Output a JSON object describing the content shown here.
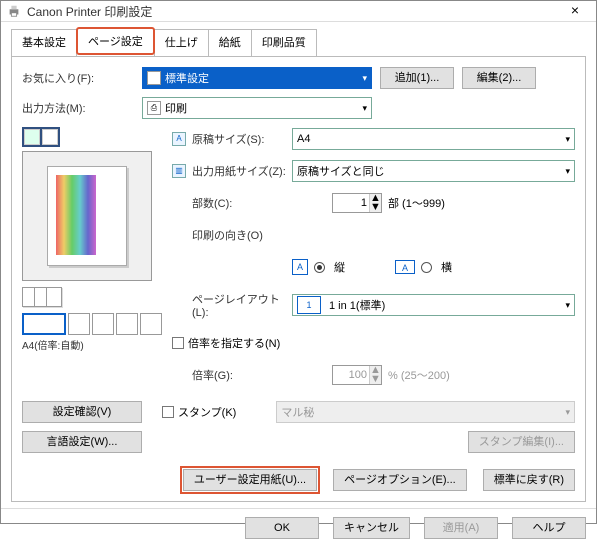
{
  "title": "Canon Printer 印刷設定",
  "tabs": [
    "基本設定",
    "ページ設定",
    "仕上げ",
    "給紙",
    "印刷品質"
  ],
  "favorite": {
    "label": "お気に入り(F):",
    "value": "標準設定",
    "add": "追加(1)...",
    "edit": "編集(2)..."
  },
  "output": {
    "label": "出力方法(M):",
    "value": "印刷"
  },
  "preview_label": "A4(倍率:自動)",
  "page_size": {
    "label": "原稿サイズ(S):",
    "value": "A4"
  },
  "out_size": {
    "label": "出力用紙サイズ(Z):",
    "value": "原稿サイズと同じ"
  },
  "copies": {
    "label": "部数(C):",
    "value": "1",
    "suffix": "部 (1～999)"
  },
  "orient": {
    "label": "印刷の向き(O)",
    "portrait": "縦",
    "landscape": "横"
  },
  "layout": {
    "label": "ページレイアウト(L):",
    "value": "1 in 1(標準)",
    "icon": "1"
  },
  "scale_chk": "倍率を指定する(N)",
  "scale": {
    "label": "倍率(G):",
    "value": "100",
    "suffix": "% (25～200)"
  },
  "side": {
    "confirm": "設定確認(V)",
    "lang": "言語設定(W)..."
  },
  "stamp": {
    "label": "スタンプ(K)",
    "value": "マル秘",
    "edit": "スタンプ編集(I)..."
  },
  "bottom": {
    "user_paper": "ユーザー設定用紙(U)...",
    "page_opt": "ページオプション(E)...",
    "restore": "標準に戻す(R)"
  },
  "dlg": {
    "ok": "OK",
    "cancel": "キャンセル",
    "apply": "適用(A)",
    "help": "ヘルプ"
  }
}
